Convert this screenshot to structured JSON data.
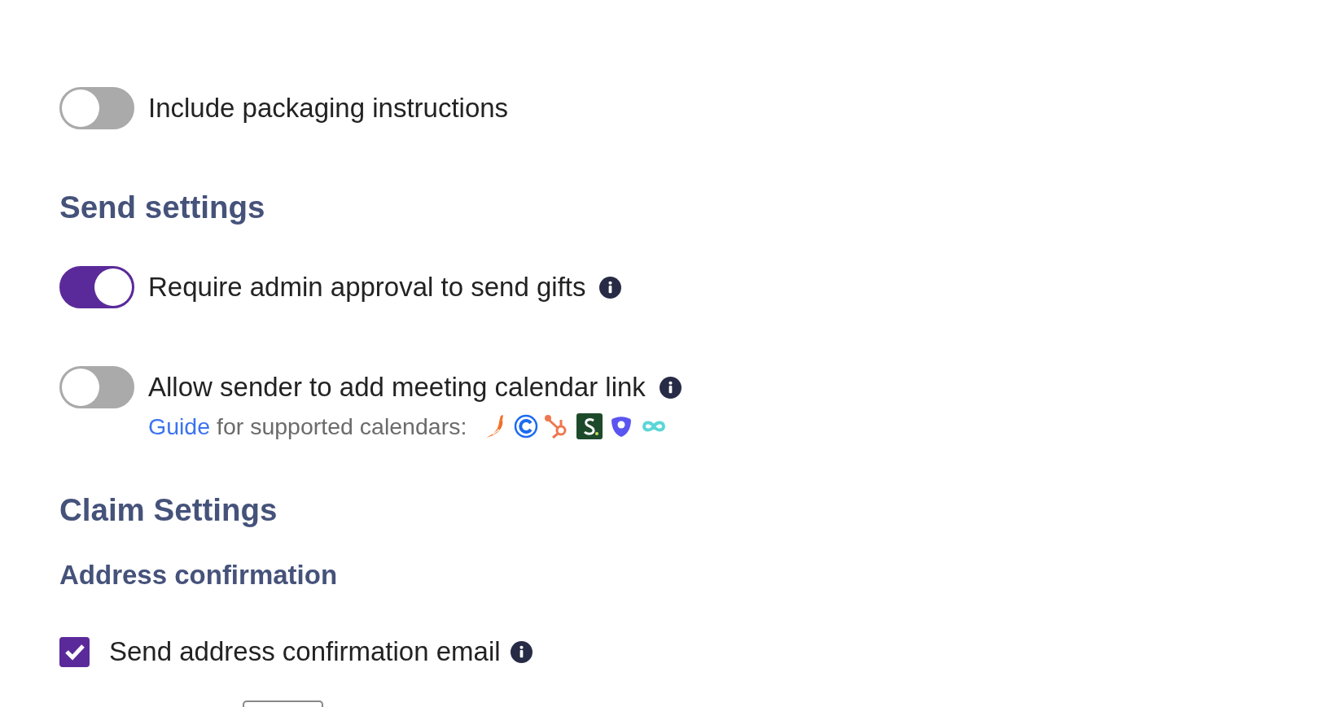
{
  "items": [
    {
      "kind": "toggle",
      "label": "Include packaging instructions",
      "on": false,
      "info": false
    },
    {
      "kind": "heading",
      "text": "Send settings"
    },
    {
      "kind": "toggle",
      "label": "Require admin approval to send gifts",
      "on": true,
      "info": true
    },
    {
      "kind": "toggle",
      "label": "Allow sender to add meeting calendar link",
      "on": false,
      "info": true,
      "guide": {
        "link": "Guide",
        "text": "for supported calendars:"
      }
    },
    {
      "kind": "heading",
      "text": "Claim Settings"
    },
    {
      "kind": "subheading",
      "text": "Address confirmation"
    },
    {
      "kind": "checkbox",
      "label": "Send address confirmation email",
      "checked": true,
      "info": true
    }
  ]
}
